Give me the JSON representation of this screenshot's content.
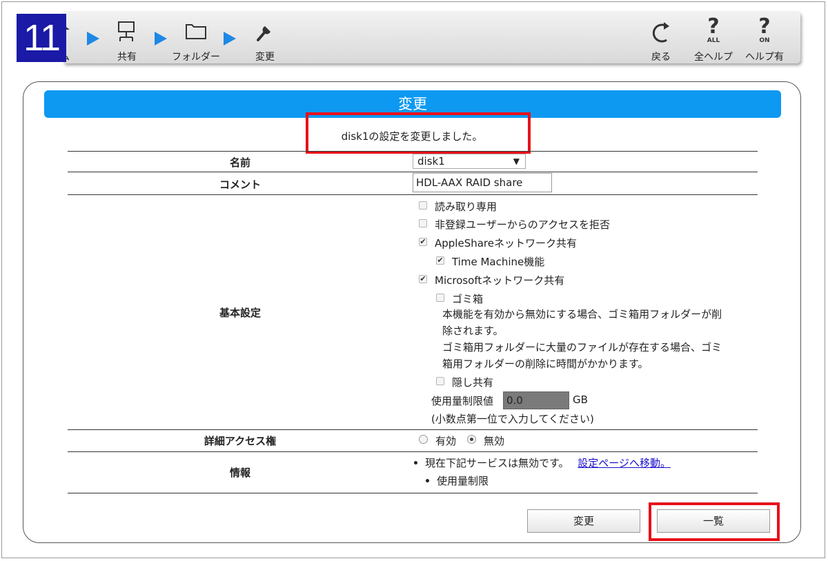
{
  "step_number": "11",
  "breadcrumb": [
    {
      "label": "ム",
      "icon": "home-icon"
    },
    {
      "label": "共有",
      "icon": "share-icon"
    },
    {
      "label": "フォルダー",
      "icon": "folder-icon"
    },
    {
      "label": "変更",
      "icon": "wrench-icon"
    }
  ],
  "toolbar": {
    "back_label": "戻る",
    "help_all_label": "全ヘルプ",
    "help_all_badge": "ALL",
    "help_on_label": "ヘルプ有",
    "help_on_badge": "ON"
  },
  "panel": {
    "title": "変更",
    "message": "disk1の設定を変更しました。"
  },
  "form": {
    "name_label": "名前",
    "name_value": "disk1",
    "comment_label": "コメント",
    "comment_value": "HDL-AAX RAID share",
    "basic_label": "基本設定",
    "options": {
      "readonly": "読み取り専用",
      "deny_unregistered": "非登録ユーザーからのアクセスを拒否",
      "appleshare": "AppleShareネットワーク共有",
      "time_machine": "Time Machine機能",
      "microsoft": "Microsoftネットワーク共有",
      "trash": "ゴミ箱",
      "trash_note_line1": "本機能を有効から無効にする場合、ゴミ箱用フォルダーが削",
      "trash_note_line2": "除されます。",
      "trash_note_line3": "ゴミ箱用フォルダーに大量のファイルが存在する場合、ゴミ",
      "trash_note_line4": "箱用フォルダーの削除に時間がかかります。",
      "hidden_share": "隠し共有",
      "quota_label": "使用量制限値",
      "quota_value": "0.0",
      "quota_unit": "GB",
      "quota_hint": "(小数点第一位で入力してください)"
    },
    "checked": {
      "readonly": false,
      "deny_unregistered": false,
      "appleshare": true,
      "time_machine": true,
      "microsoft": true,
      "trash": false,
      "hidden_share": false
    },
    "access_label": "詳細アクセス権",
    "access_enabled": "有効",
    "access_disabled": "無効",
    "access_selected": "無効",
    "info_label": "情報",
    "info_text": "現在下記サービスは無効です。",
    "info_link": "設定ページへ移動。",
    "info_item": "使用量制限"
  },
  "buttons": {
    "change": "変更",
    "list": "一覧"
  },
  "colors": {
    "step_badge": "#1a1aa6",
    "title_bar": "#0d99f2",
    "highlight": "#e8101a",
    "arrow": "#1e88e5"
  }
}
